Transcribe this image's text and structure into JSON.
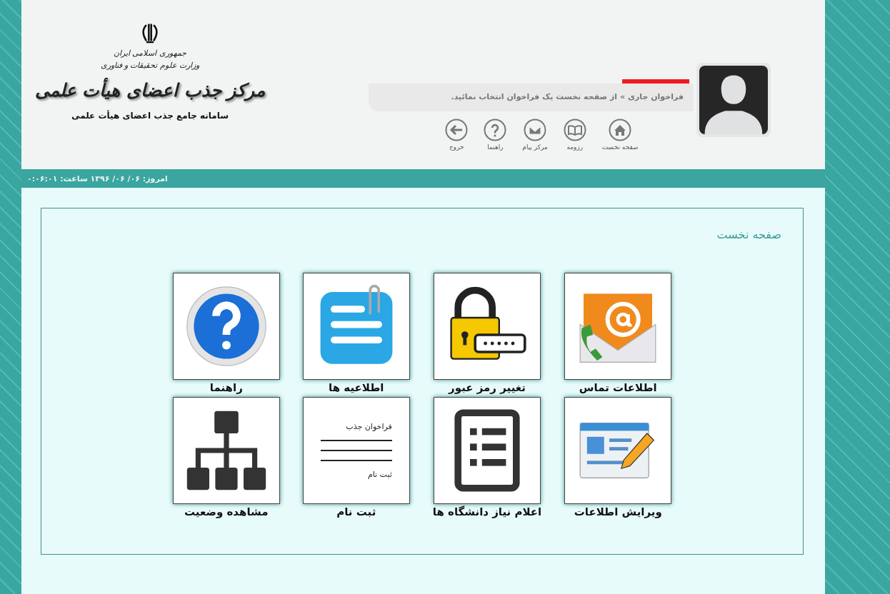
{
  "logo": {
    "country": "جمهوری اسلامی ایران",
    "ministry": "وزارت علوم تحقیقات و فناوری",
    "title": "مرکز جذب اعضای هیأت علمی",
    "subtitle": "سامانه جامع جذب اعضای هیأت علمی"
  },
  "user": {
    "notice": "فراخوان جاری » از صفحه نخست یک فراخوان انتخاب نمائید."
  },
  "nav": [
    {
      "kind": "home",
      "label": "صفحه نخست"
    },
    {
      "kind": "book",
      "label": "رزومه"
    },
    {
      "kind": "mail",
      "label": "مرکز پیام"
    },
    {
      "kind": "help",
      "label": "راهنما"
    },
    {
      "kind": "exit",
      "label": "خروج"
    }
  ],
  "status_bar": {
    "text": "امروز: ۰۶/ ۰۶/ ۱۳۹۶ ساعت: ۰:۰۶:۰۱"
  },
  "panel": {
    "title": "صفحه نخست"
  },
  "tiles": [
    {
      "kind": "contact",
      "label": "اطلاعات تماس"
    },
    {
      "kind": "lock",
      "label": "تغییر رمز عبور"
    },
    {
      "kind": "notice",
      "label": "اطلاعیه ها"
    },
    {
      "kind": "help",
      "label": "راهنما"
    },
    {
      "kind": "edit",
      "label": "ویرایش اطلاعات"
    },
    {
      "kind": "list",
      "label": "اعلام نیاز دانشگاه ها"
    },
    {
      "kind": "form",
      "label": "ثبت نام",
      "lines": [
        "فراخوان جذب",
        "ثبت نام"
      ]
    },
    {
      "kind": "tree",
      "label": "مشاهده وضعیت"
    }
  ]
}
